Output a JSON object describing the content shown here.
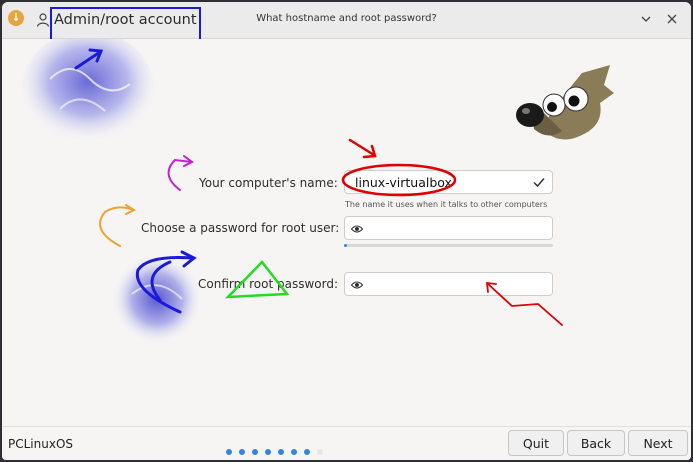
{
  "titlebar": {
    "account_label": "Admin/root account",
    "window_title": "What hostname and root password?"
  },
  "form": {
    "hostname_label": "Your computer's name:",
    "hostname_value": "linux-virtualbox",
    "hostname_hint": "The name it uses when it talks to other computers",
    "password_label": "Choose a password for root user:",
    "confirm_label": "Confirm root password:",
    "password_strength": 0.015
  },
  "footer": {
    "brand": "PCLinuxOS",
    "steps_total": 8,
    "steps_done": 7,
    "quit_label": "Quit",
    "back_label": "Back",
    "next_label": "Next"
  },
  "icons": {
    "app": "installer-icon",
    "account": "person-icon",
    "check": "check-icon",
    "eye": "eye-icon",
    "mascot": "gimp-wilber-mascot"
  },
  "colors": {
    "accent": "#3584e4",
    "annotation_red": "#e00000",
    "annotation_blue": "#1a1ad8",
    "annotation_orange": "#f0a030",
    "annotation_magenta": "#c81ecf",
    "annotation_green": "#22dd22"
  }
}
